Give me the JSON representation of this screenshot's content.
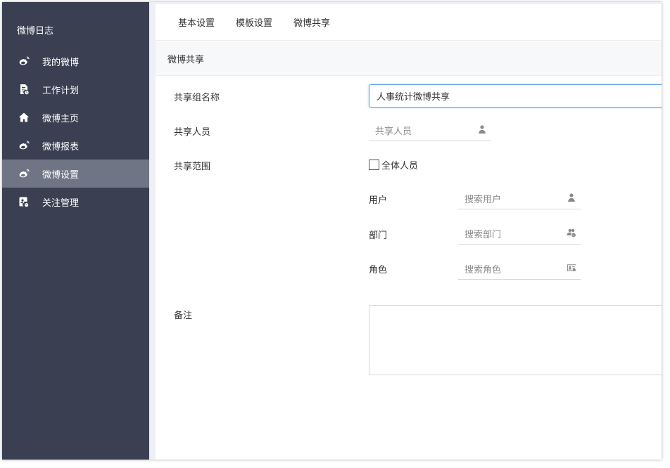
{
  "sidebar": {
    "title": "微博日志",
    "items": [
      {
        "label": "我的微博",
        "icon": "weibo-icon"
      },
      {
        "label": "工作计划",
        "icon": "plan-icon"
      },
      {
        "label": "微博主页",
        "icon": "home-icon"
      },
      {
        "label": "微博报表",
        "icon": "weibo-icon"
      },
      {
        "label": "微博设置",
        "icon": "weibo-icon",
        "active": true
      },
      {
        "label": "关注管理",
        "icon": "follow-icon"
      }
    ]
  },
  "tabs": [
    {
      "label": "基本设置"
    },
    {
      "label": "模板设置"
    },
    {
      "label": "微博共享"
    }
  ],
  "section": {
    "title": "微博共享"
  },
  "form": {
    "group_name_label": "共享组名称",
    "group_name_value": "人事统计微博共享",
    "members_label": "共享人员",
    "members_placeholder": "共享人员",
    "scope_label": "共享范围",
    "all_members_label": "全体人员",
    "user_label": "用户",
    "user_placeholder": "搜索用户",
    "dept_label": "部门",
    "dept_placeholder": "搜索部门",
    "role_label": "角色",
    "role_placeholder": "搜索角色",
    "remark_label": "备注"
  },
  "colors": {
    "sidebar_bg": "#3a4052",
    "sidebar_active": "#707585",
    "focus_border": "#5a9be8"
  }
}
